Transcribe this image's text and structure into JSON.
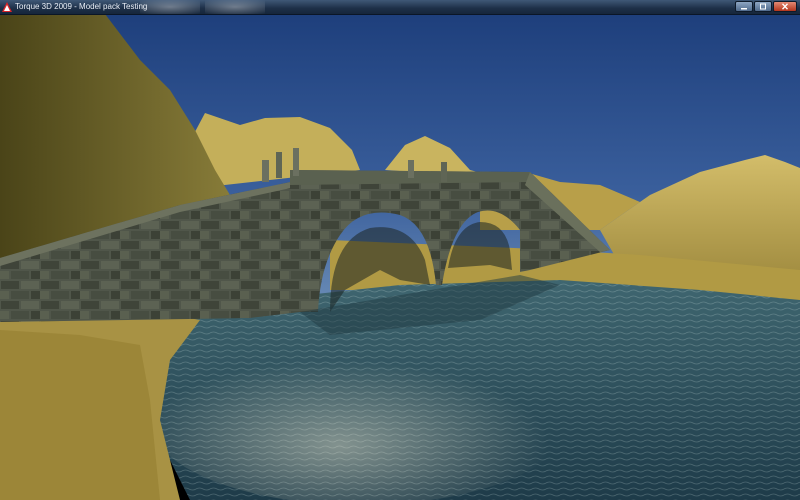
{
  "window": {
    "title": "Torque 3D 2009 - Model pack Testing",
    "icon": "torque-app-icon",
    "controls": [
      "minimize-icon",
      "maximize-icon",
      "close-icon"
    ]
  },
  "scene": {
    "sky_color": "#3a5f9c",
    "terrain_color": "#c9b35c",
    "water_color": "#2c4f5c",
    "bridge_color": "#4e5447"
  }
}
